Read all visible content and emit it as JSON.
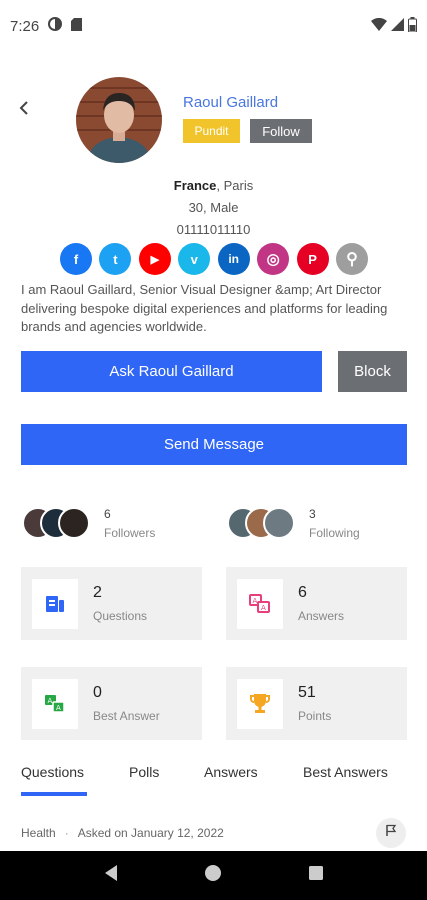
{
  "status_bar": {
    "time": "7:26"
  },
  "profile": {
    "name": "Raoul Gaillard",
    "badge": "Pundit",
    "follow_label": "Follow",
    "country": "France",
    "city_sep": ", Paris",
    "age_gender": "30, Male",
    "phone": "01111011110",
    "bio": "I am Raoul Gaillard, Senior Visual Designer &amp; Art Director delivering bespoke digital experiences and platforms for leading brands and agencies worldwide."
  },
  "social": [
    {
      "name": "facebook",
      "color": "#1877f2",
      "glyph": "f"
    },
    {
      "name": "twitter",
      "color": "#1da1f2",
      "glyph": "t"
    },
    {
      "name": "youtube",
      "color": "#ff0000",
      "glyph": "▶"
    },
    {
      "name": "vimeo",
      "color": "#1ab7ea",
      "glyph": "v"
    },
    {
      "name": "linkedin",
      "color": "#0a66c2",
      "glyph": "in"
    },
    {
      "name": "instagram",
      "color": "#c13584",
      "glyph": "◎"
    },
    {
      "name": "pinterest",
      "color": "#e60023",
      "glyph": "P"
    },
    {
      "name": "link",
      "color": "#9e9e9e",
      "glyph": "⚲"
    }
  ],
  "actions": {
    "ask_label": "Ask Raoul Gaillard",
    "block_label": "Block",
    "message_label": "Send Message"
  },
  "followers": {
    "count": "6",
    "label": "Followers"
  },
  "following": {
    "count": "3",
    "label": "Following"
  },
  "stats": {
    "questions": {
      "value": "2",
      "label": "Questions"
    },
    "answers": {
      "value": "6",
      "label": "Answers"
    },
    "best_answer": {
      "value": "0",
      "label": "Best Answer"
    },
    "points": {
      "value": "51",
      "label": "Points"
    }
  },
  "tabs": [
    "Questions",
    "Polls",
    "Answers",
    "Best Answers"
  ],
  "post": {
    "category": "Health",
    "separator": "·",
    "date": "Asked on January 12, 2022"
  },
  "colors": {
    "accent": "#2f66f6",
    "pundit": "#f0c42a",
    "grey_button": "#6b6f73",
    "link": "#4a76e0"
  }
}
